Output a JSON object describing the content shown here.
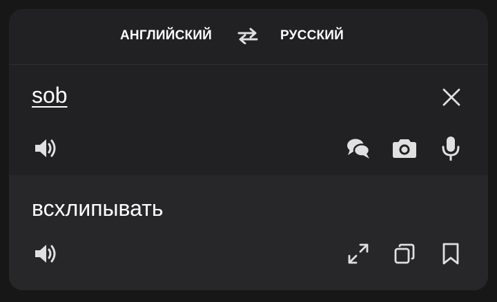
{
  "languages": {
    "source": "АНГЛИЙСКИЙ",
    "target": "РУССКИЙ"
  },
  "input": {
    "text": "sob"
  },
  "output": {
    "text": "всхлипывать"
  },
  "icons": {
    "swap": "swap-arrows-icon",
    "clear": "close-icon",
    "speak_source": "speaker-icon",
    "conversation": "conversation-icon",
    "camera": "camera-icon",
    "microphone": "microphone-icon",
    "speak_target": "speaker-icon",
    "fullscreen": "expand-icon",
    "copy": "copy-icon",
    "bookmark": "bookmark-icon"
  },
  "colors": {
    "background": "#171717",
    "card": "#212124",
    "output_panel": "#27272a",
    "text": "#ffffff",
    "icon": "#e0e0e0"
  }
}
